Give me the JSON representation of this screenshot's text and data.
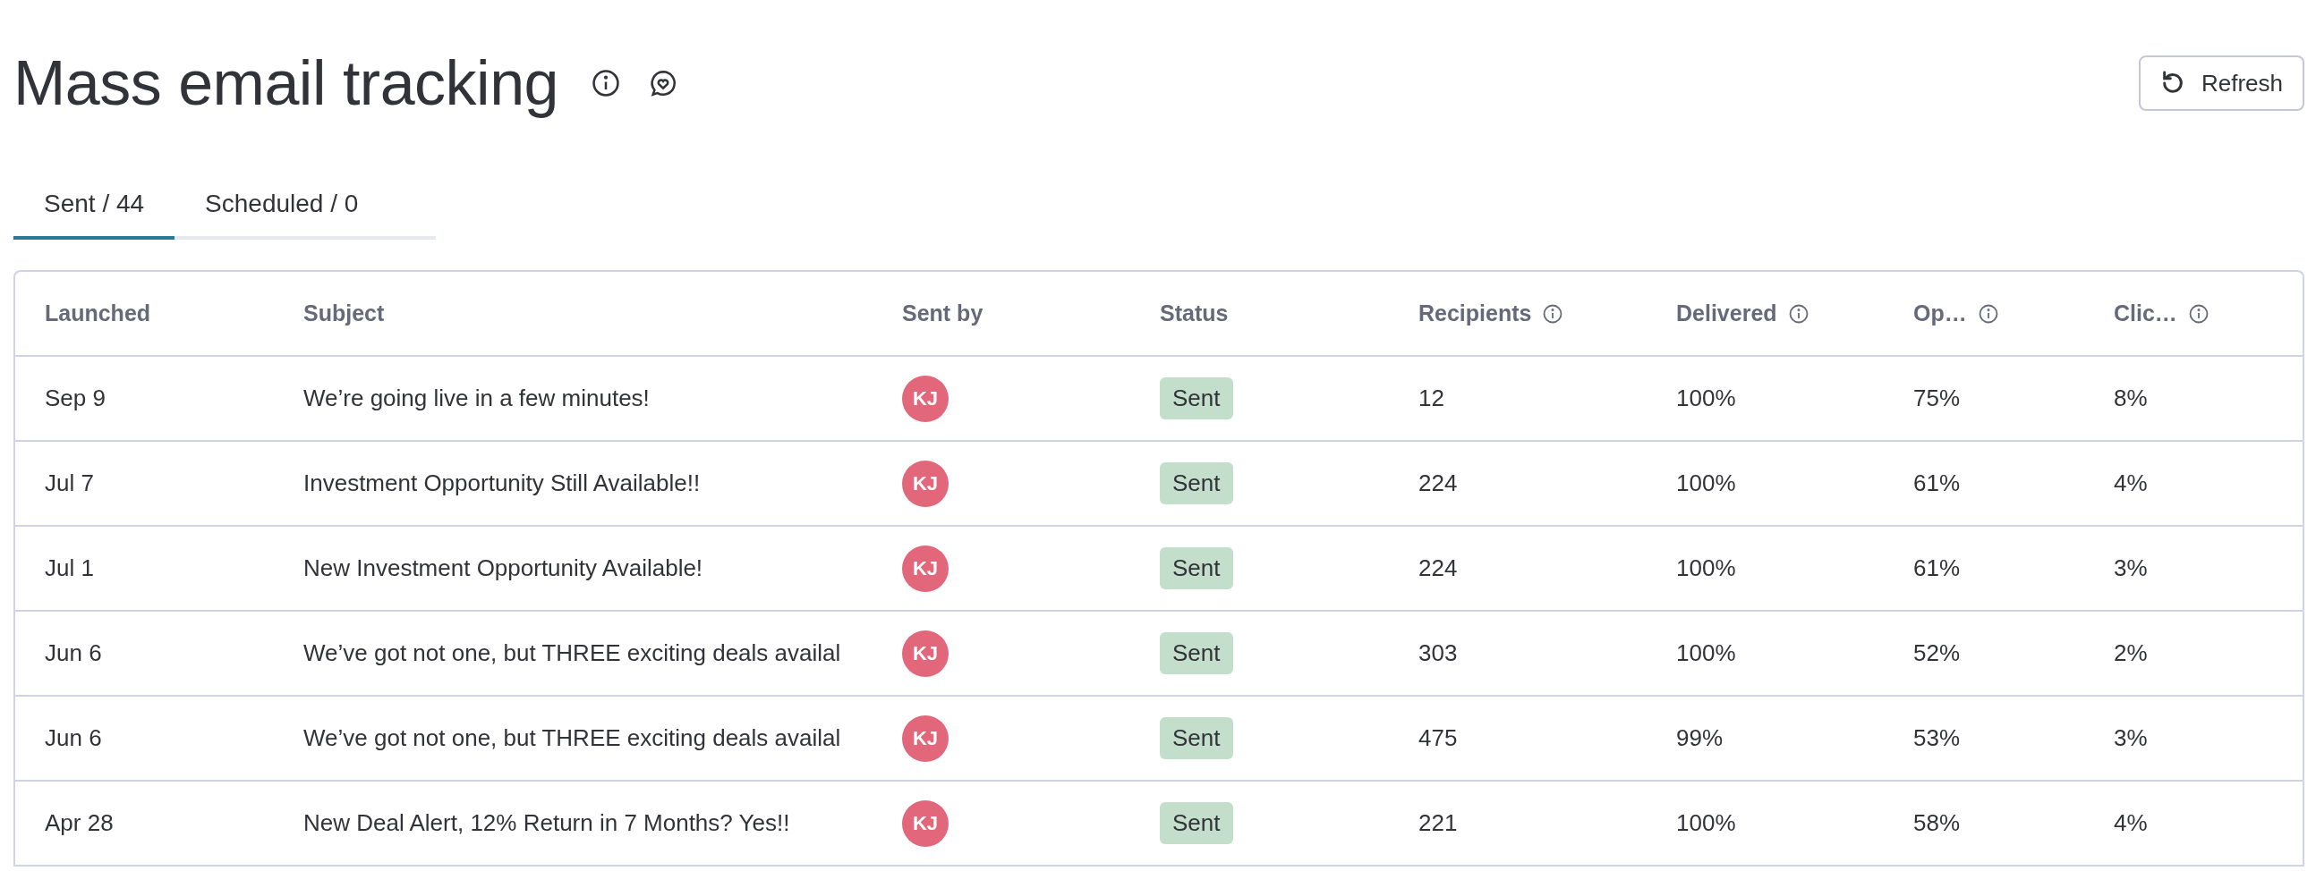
{
  "page": {
    "title": "Mass email tracking",
    "refresh_button": "Refresh"
  },
  "tabs": [
    {
      "label": "Sent / 44",
      "selected": true
    },
    {
      "label": "Scheduled / 0",
      "selected": false
    }
  ],
  "table": {
    "columns": [
      {
        "label": "Launched",
        "info": false
      },
      {
        "label": "Subject",
        "info": false
      },
      {
        "label": "Sent by",
        "info": false
      },
      {
        "label": "Status",
        "info": false
      },
      {
        "label": "Recipients",
        "info": true
      },
      {
        "label": "Delivered",
        "info": true
      },
      {
        "label": "Op…",
        "info": true
      },
      {
        "label": "Clic…",
        "info": true
      }
    ],
    "rows": [
      {
        "launched": "Sep 9",
        "subject": "We’re going live in a few minutes!",
        "sent_by": "KJ",
        "status": "Sent",
        "recipients": "12",
        "delivered": "100%",
        "opened": "75%",
        "clicked": "8%"
      },
      {
        "launched": "Jul 7",
        "subject": "Investment Opportunity Still Available!!",
        "sent_by": "KJ",
        "status": "Sent",
        "recipients": "224",
        "delivered": "100%",
        "opened": "61%",
        "clicked": "4%"
      },
      {
        "launched": "Jul 1",
        "subject": "New Investment Opportunity Available!",
        "sent_by": "KJ",
        "status": "Sent",
        "recipients": "224",
        "delivered": "100%",
        "opened": "61%",
        "clicked": "3%"
      },
      {
        "launched": "Jun 6",
        "subject": "We’ve got not one, but THREE exciting deals availal",
        "sent_by": "KJ",
        "status": "Sent",
        "recipients": "303",
        "delivered": "100%",
        "opened": "52%",
        "clicked": "2%"
      },
      {
        "launched": "Jun 6",
        "subject": "We’ve got not one, but THREE exciting deals availal",
        "sent_by": "KJ",
        "status": "Sent",
        "recipients": "475",
        "delivered": "99%",
        "opened": "53%",
        "clicked": "3%"
      },
      {
        "launched": "Apr 28",
        "subject": "New Deal Alert, 12% Return in 7 Months? Yes!!",
        "sent_by": "KJ",
        "status": "Sent",
        "recipients": "221",
        "delivered": "100%",
        "opened": "58%",
        "clicked": "4%"
      }
    ]
  }
}
